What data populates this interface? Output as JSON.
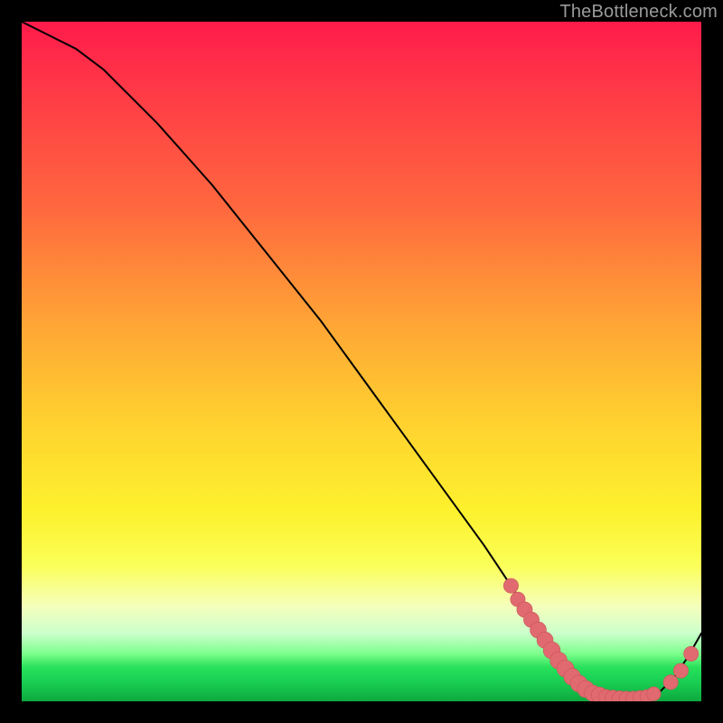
{
  "attribution": "TheBottleneck.com",
  "colors": {
    "curve": "#000000",
    "marker_fill": "#e06a6f",
    "marker_stroke": "#c9555a",
    "gradient_top": "#ff1b4b",
    "gradient_bottom": "#0ea83e"
  },
  "chart_data": {
    "type": "line",
    "title": "",
    "xlabel": "",
    "ylabel": "",
    "xlim": [
      0,
      100
    ],
    "ylim": [
      0,
      100
    ],
    "grid": false,
    "legend": false,
    "series": [
      {
        "name": "curve",
        "x": [
          0,
          4,
          8,
          12,
          16,
          20,
          24,
          28,
          32,
          36,
          40,
          44,
          48,
          52,
          56,
          60,
          64,
          68,
          70,
          72,
          74,
          76,
          78,
          80,
          82,
          84,
          86,
          88,
          90,
          92,
          94,
          96,
          98,
          100
        ],
        "y": [
          100,
          98,
          96,
          93,
          89,
          85,
          80.5,
          76,
          71,
          66,
          61,
          56,
          50.5,
          45,
          39.5,
          34,
          28.5,
          23,
          20,
          17,
          14,
          11,
          8,
          5,
          3,
          1.5,
          0.8,
          0.4,
          0.3,
          0.5,
          1.5,
          3.5,
          6.5,
          10
        ]
      }
    ],
    "markers": [
      {
        "x": 72.0,
        "y": 17.0,
        "r": 1.2
      },
      {
        "x": 73.0,
        "y": 15.0,
        "r": 1.2
      },
      {
        "x": 74.0,
        "y": 13.5,
        "r": 1.3
      },
      {
        "x": 75.0,
        "y": 12.0,
        "r": 1.3
      },
      {
        "x": 76.0,
        "y": 10.5,
        "r": 1.4
      },
      {
        "x": 77.0,
        "y": 9.0,
        "r": 1.4
      },
      {
        "x": 78.0,
        "y": 7.5,
        "r": 1.5
      },
      {
        "x": 79.0,
        "y": 6.0,
        "r": 1.5
      },
      {
        "x": 80.0,
        "y": 4.8,
        "r": 1.5
      },
      {
        "x": 81.0,
        "y": 3.6,
        "r": 1.5
      },
      {
        "x": 82.0,
        "y": 2.6,
        "r": 1.5
      },
      {
        "x": 83.0,
        "y": 1.8,
        "r": 1.5
      },
      {
        "x": 84.0,
        "y": 1.2,
        "r": 1.4
      },
      {
        "x": 85.0,
        "y": 0.9,
        "r": 1.4
      },
      {
        "x": 86.0,
        "y": 0.6,
        "r": 1.3
      },
      {
        "x": 87.0,
        "y": 0.5,
        "r": 1.3
      },
      {
        "x": 88.0,
        "y": 0.4,
        "r": 1.3
      },
      {
        "x": 89.0,
        "y": 0.4,
        "r": 1.2
      },
      {
        "x": 90.0,
        "y": 0.4,
        "r": 1.2
      },
      {
        "x": 91.0,
        "y": 0.5,
        "r": 1.2
      },
      {
        "x": 92.0,
        "y": 0.7,
        "r": 1.1
      },
      {
        "x": 93.0,
        "y": 1.1,
        "r": 1.1
      },
      {
        "x": 95.5,
        "y": 2.8,
        "r": 1.2
      },
      {
        "x": 97.0,
        "y": 4.5,
        "r": 1.2
      },
      {
        "x": 98.5,
        "y": 7.0,
        "r": 1.2
      }
    ]
  }
}
